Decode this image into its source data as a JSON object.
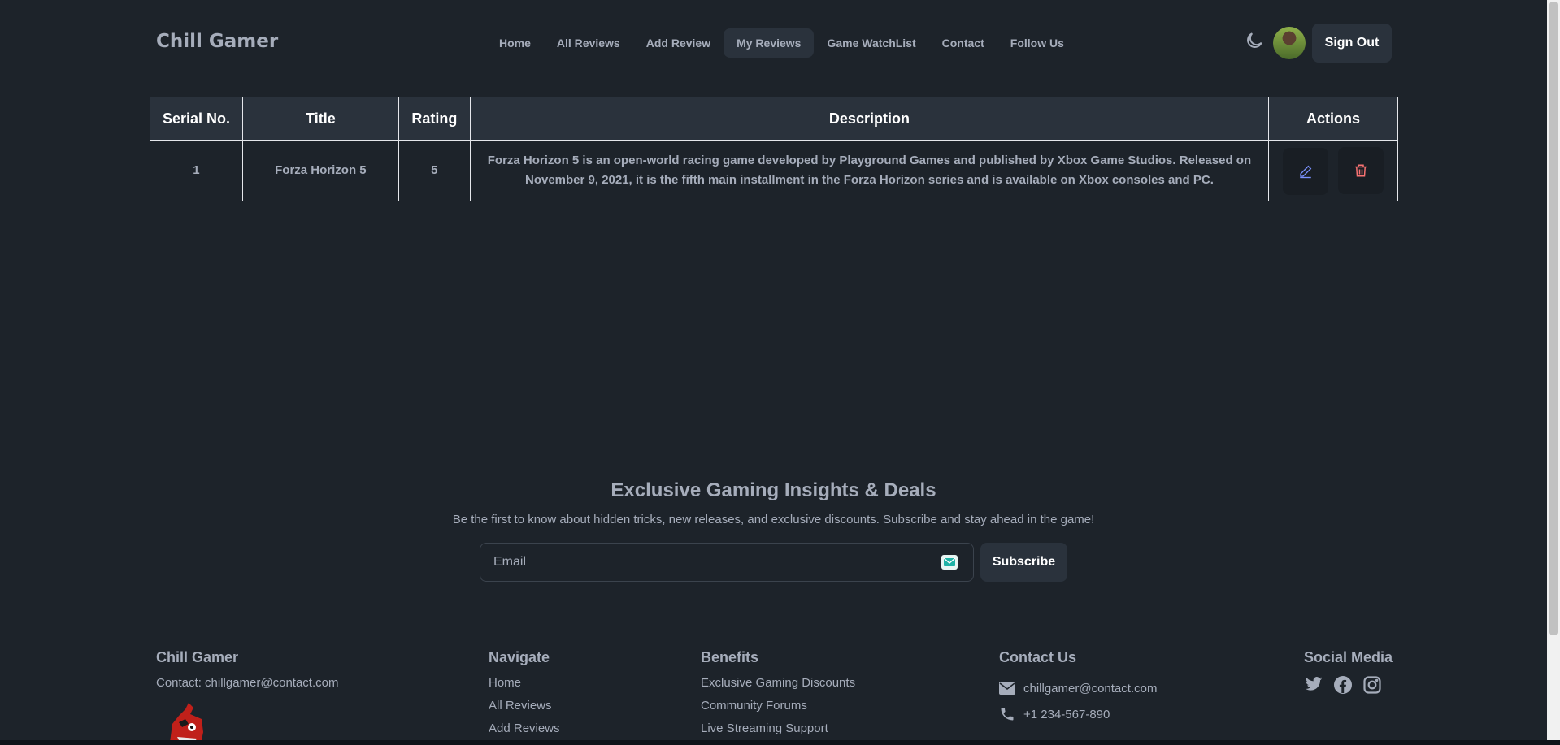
{
  "nav": {
    "brand": "Chill Gamer",
    "links": [
      "Home",
      "All Reviews",
      "Add Review",
      "My Reviews",
      "Game WatchList",
      "Contact",
      "Follow Us"
    ],
    "active": "My Reviews",
    "signout_label": "Sign Out"
  },
  "table": {
    "headers": [
      "Serial No.",
      "Title",
      "Rating",
      "Description",
      "Actions"
    ],
    "rows": [
      {
        "serial": "1",
        "title": "Forza Horizon 5",
        "rating": "5",
        "description": "Forza Horizon 5 is an open-world racing game developed by Playground Games and published by Xbox Game Studios. Released on November 9, 2021, it is the fifth main installment in the Forza Horizon series and is available on Xbox consoles and PC."
      }
    ]
  },
  "newsletter": {
    "title": "Exclusive Gaming Insights & Deals",
    "subtitle": "Be the first to know about hidden tricks, new releases, and exclusive discounts. Subscribe and stay ahead in the game!",
    "email_placeholder": "Email",
    "subscribe_label": "Subscribe"
  },
  "footer": {
    "brand": {
      "title": "Chill Gamer",
      "contact": "Contact: chillgamer@contact.com"
    },
    "navigate": {
      "title": "Navigate",
      "items": [
        "Home",
        "All Reviews",
        "Add Reviews"
      ]
    },
    "benefits": {
      "title": "Benefits",
      "items": [
        "Exclusive Gaming Discounts",
        "Community Forums",
        "Live Streaming Support"
      ]
    },
    "contact": {
      "title": "Contact Us",
      "email": "chillgamer@contact.com",
      "phone": "+1 234-567-890"
    },
    "social": {
      "title": "Social Media",
      "icons": [
        "twitter-icon",
        "facebook-icon",
        "instagram-icon"
      ]
    }
  },
  "colors": {
    "background": "#1d232a",
    "surface": "#2a323c",
    "text": "#a6adbb",
    "delete": "#f87272",
    "edit": "#7b92ff",
    "mail": "#1fb2a6"
  }
}
